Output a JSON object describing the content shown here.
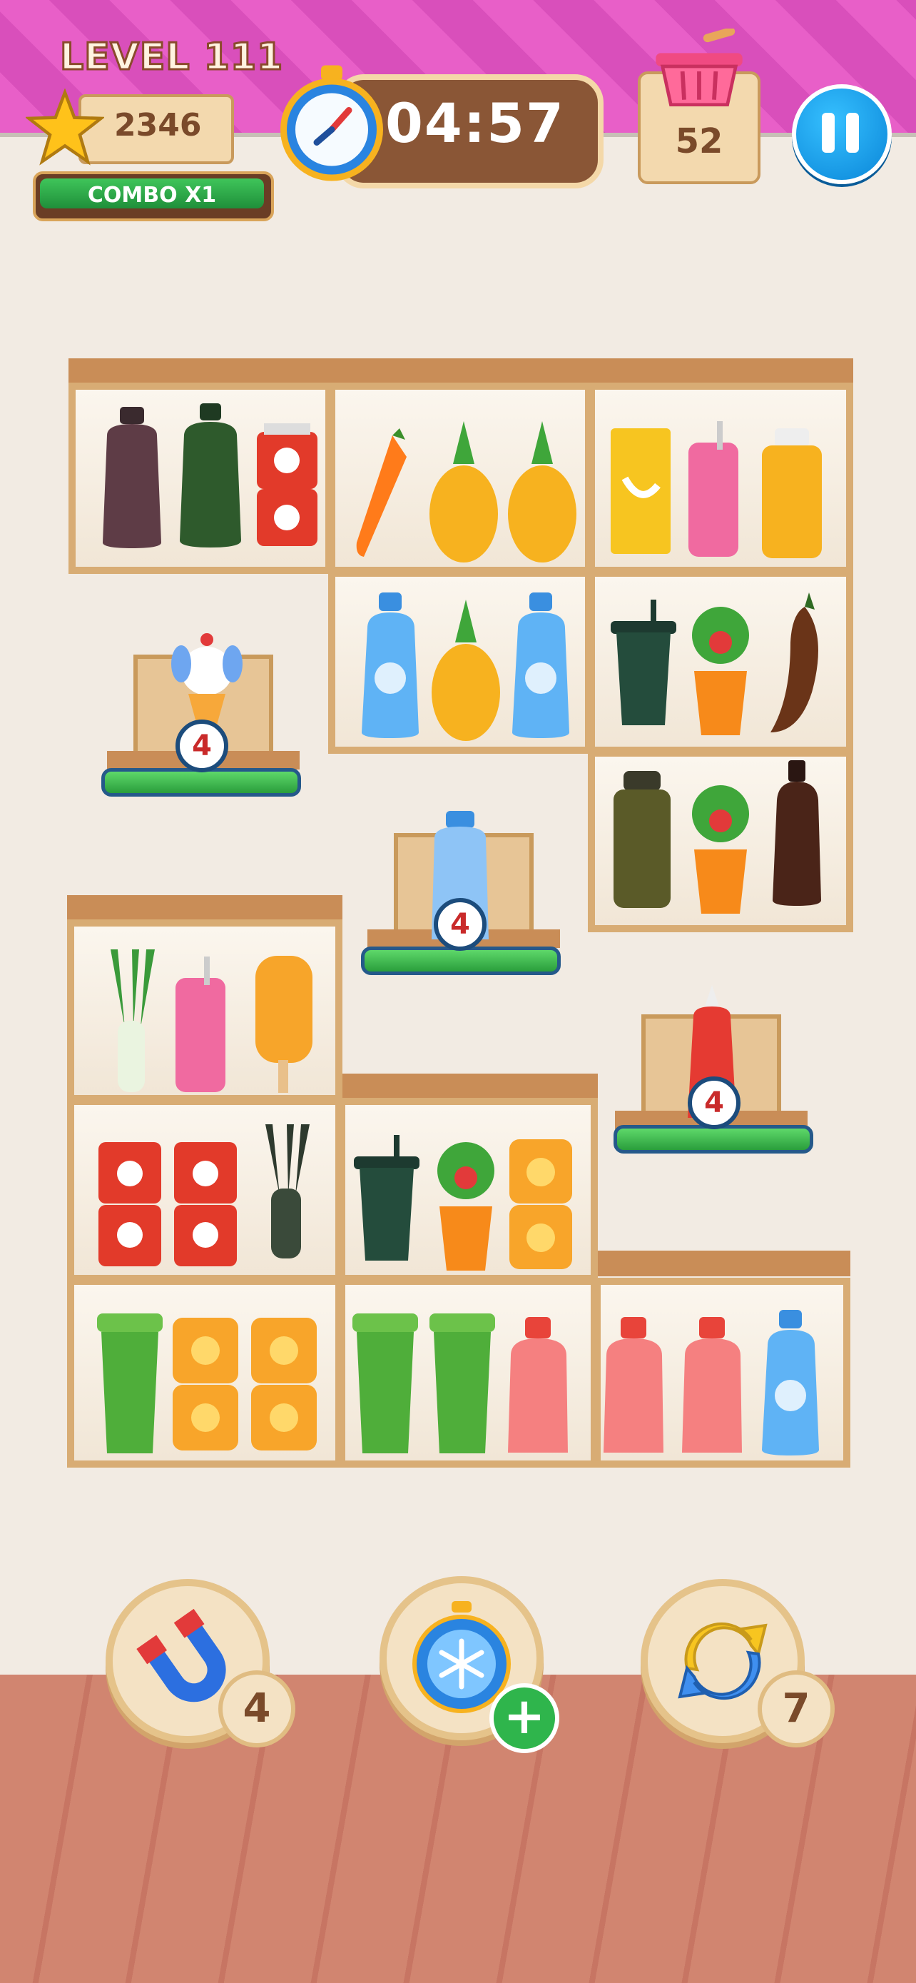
{
  "header": {
    "level_label": "LEVEL 111",
    "coins": "2346",
    "combo_label": "COMBO X1",
    "timer": "04:57",
    "basket_count": "52"
  },
  "stands": [
    {
      "name": "bunny-icecream-stand",
      "count": "4"
    },
    {
      "name": "milk-stand",
      "count": "4"
    },
    {
      "name": "ketchup-stand",
      "count": "4"
    }
  ],
  "boosters": [
    {
      "name": "magnet",
      "count": "4"
    },
    {
      "name": "freeze",
      "count": "+"
    },
    {
      "name": "shuffle",
      "count": "7"
    }
  ],
  "colors": {
    "accent": "#e85fc8",
    "shelf": "#d8ac74",
    "green": "#2fb54c",
    "blue": "#0a86d8"
  }
}
